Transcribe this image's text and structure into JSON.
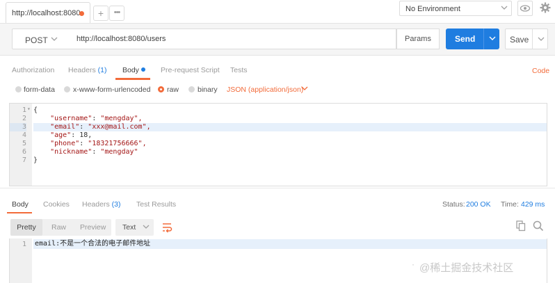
{
  "topbar": {
    "tab_label": "http://localhost:8080",
    "new_tab": "+",
    "overflow": "•••",
    "environment": "No Environment"
  },
  "request": {
    "method": "POST",
    "url": "http://localhost:8080/users",
    "params_label": "Params",
    "send_label": "Send",
    "save_label": "Save"
  },
  "builder_tabs": {
    "authorization": "Authorization",
    "headers": "Headers",
    "headers_count": "(1)",
    "body": "Body",
    "prerequest": "Pre-request Script",
    "tests": "Tests",
    "code": "Code"
  },
  "body_modes": {
    "form_data": "form-data",
    "urlencoded": "x-www-form-urlencoded",
    "raw": "raw",
    "binary": "binary",
    "selected": "raw",
    "content_type": "JSON (application/json)"
  },
  "editor": {
    "lines": [
      {
        "num": "1",
        "text": "{"
      },
      {
        "num": "2",
        "key": "\"username\"",
        "value": "\"mengday\","
      },
      {
        "num": "3",
        "key": "\"email\"",
        "value": "\"xxx@mail.com\","
      },
      {
        "num": "4",
        "key": "\"age\"",
        "value": "18,"
      },
      {
        "num": "5",
        "key": "\"phone\"",
        "value": "\"18321756666\","
      },
      {
        "num": "6",
        "key": "\"nickname\"",
        "value": "\"mengday\""
      },
      {
        "num": "7",
        "text": "}"
      }
    ],
    "active_line": 3
  },
  "response": {
    "tabs": {
      "body": "Body",
      "cookies": "Cookies",
      "headers": "Headers",
      "headers_count": "(3)",
      "test_results": "Test Results"
    },
    "status_label": "Status:",
    "status_value": "200 OK",
    "time_label": "Time:",
    "time_value": "429 ms",
    "views": {
      "pretty": "Pretty",
      "raw": "Raw",
      "preview": "Preview"
    },
    "format": "Text",
    "line_num": "1",
    "line_text": "email:不是一个合法的电子邮件地址"
  },
  "watermark": "@稀土掘金技术社区",
  "colors": {
    "accent": "#f26b3a",
    "send_blue": "#1f7de0"
  }
}
